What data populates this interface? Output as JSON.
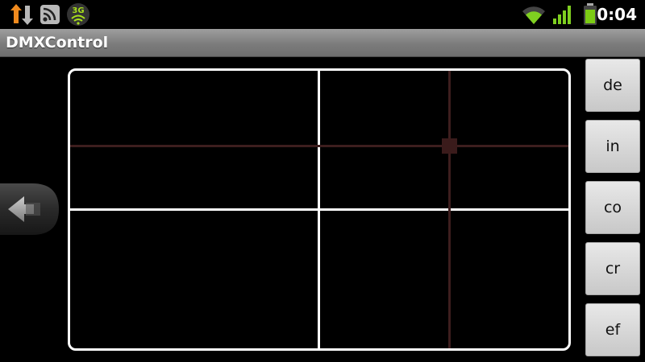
{
  "status_bar": {
    "clock": "0:04",
    "network_badge": "3G",
    "left_icons": [
      "usb-debug-icon",
      "rss-feed-icon",
      "network-3g-icon"
    ],
    "right_icons": [
      "wifi-icon",
      "cell-signal-icon",
      "battery-icon"
    ],
    "colors": {
      "usb_orange": "#f08a1e",
      "feed_gray": "#b8b8b8",
      "signal_green": "#7fcf20",
      "battery_green": "#7ccc14"
    }
  },
  "app": {
    "title": "DMXControl"
  },
  "xy_pad": {
    "cursor_x": 0.76,
    "cursor_y": 0.27,
    "grid_color": "#ffffff",
    "crosshair_color": "#3d1e1e"
  },
  "nav": {
    "back_icon": "arrow-left-icon"
  },
  "side_buttons": [
    {
      "id": "de",
      "label": "de"
    },
    {
      "id": "in",
      "label": "in"
    },
    {
      "id": "co",
      "label": "co"
    },
    {
      "id": "cr",
      "label": "cr"
    },
    {
      "id": "ef",
      "label": "ef"
    }
  ]
}
